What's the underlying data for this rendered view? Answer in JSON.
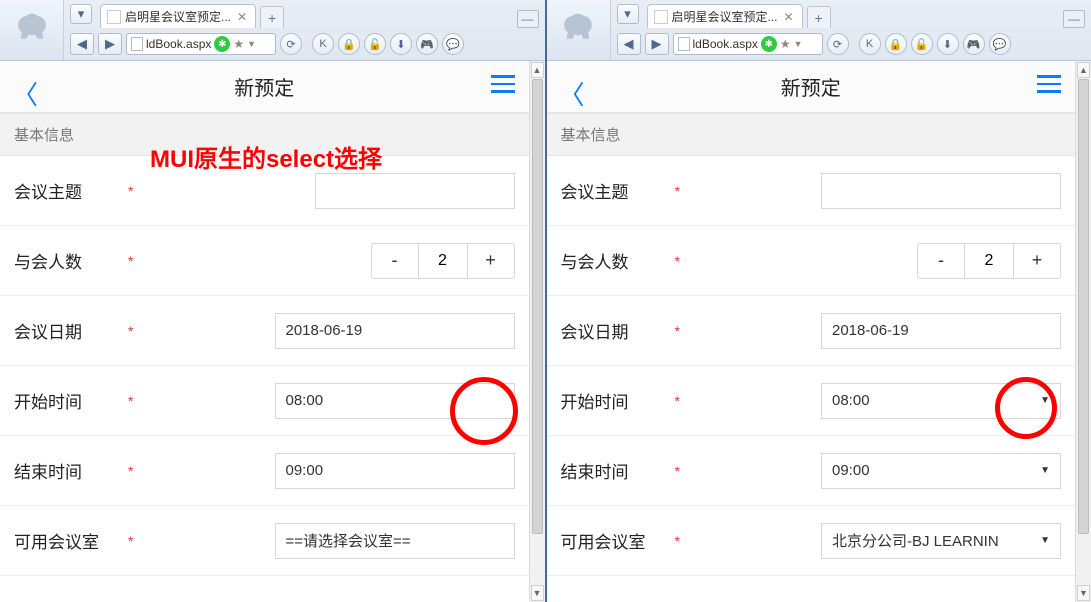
{
  "browser": {
    "tab_title": "启明星会议室预定...",
    "url_text": "ldBook.aspx",
    "toolbar_letter": "K"
  },
  "annotation": {
    "red_text": "MUI原生的select选择"
  },
  "app": {
    "header": {
      "title": "新预定"
    },
    "section_label": "基本信息",
    "fields": {
      "subject_label": "会议主题",
      "attendees_label": "与会人数",
      "attendees_value": "2",
      "date_label": "会议日期",
      "date_value": "2018-06-19",
      "start_label": "开始时间",
      "start_value": "08:00",
      "end_label": "结束时间",
      "end_value": "09:00",
      "room_label": "可用会议室",
      "room_placeholder_left": "==请选择会议室==",
      "room_value_right": "北京分公司-BJ LEARNIN"
    },
    "stepper": {
      "minus": "-",
      "plus": "+"
    }
  }
}
